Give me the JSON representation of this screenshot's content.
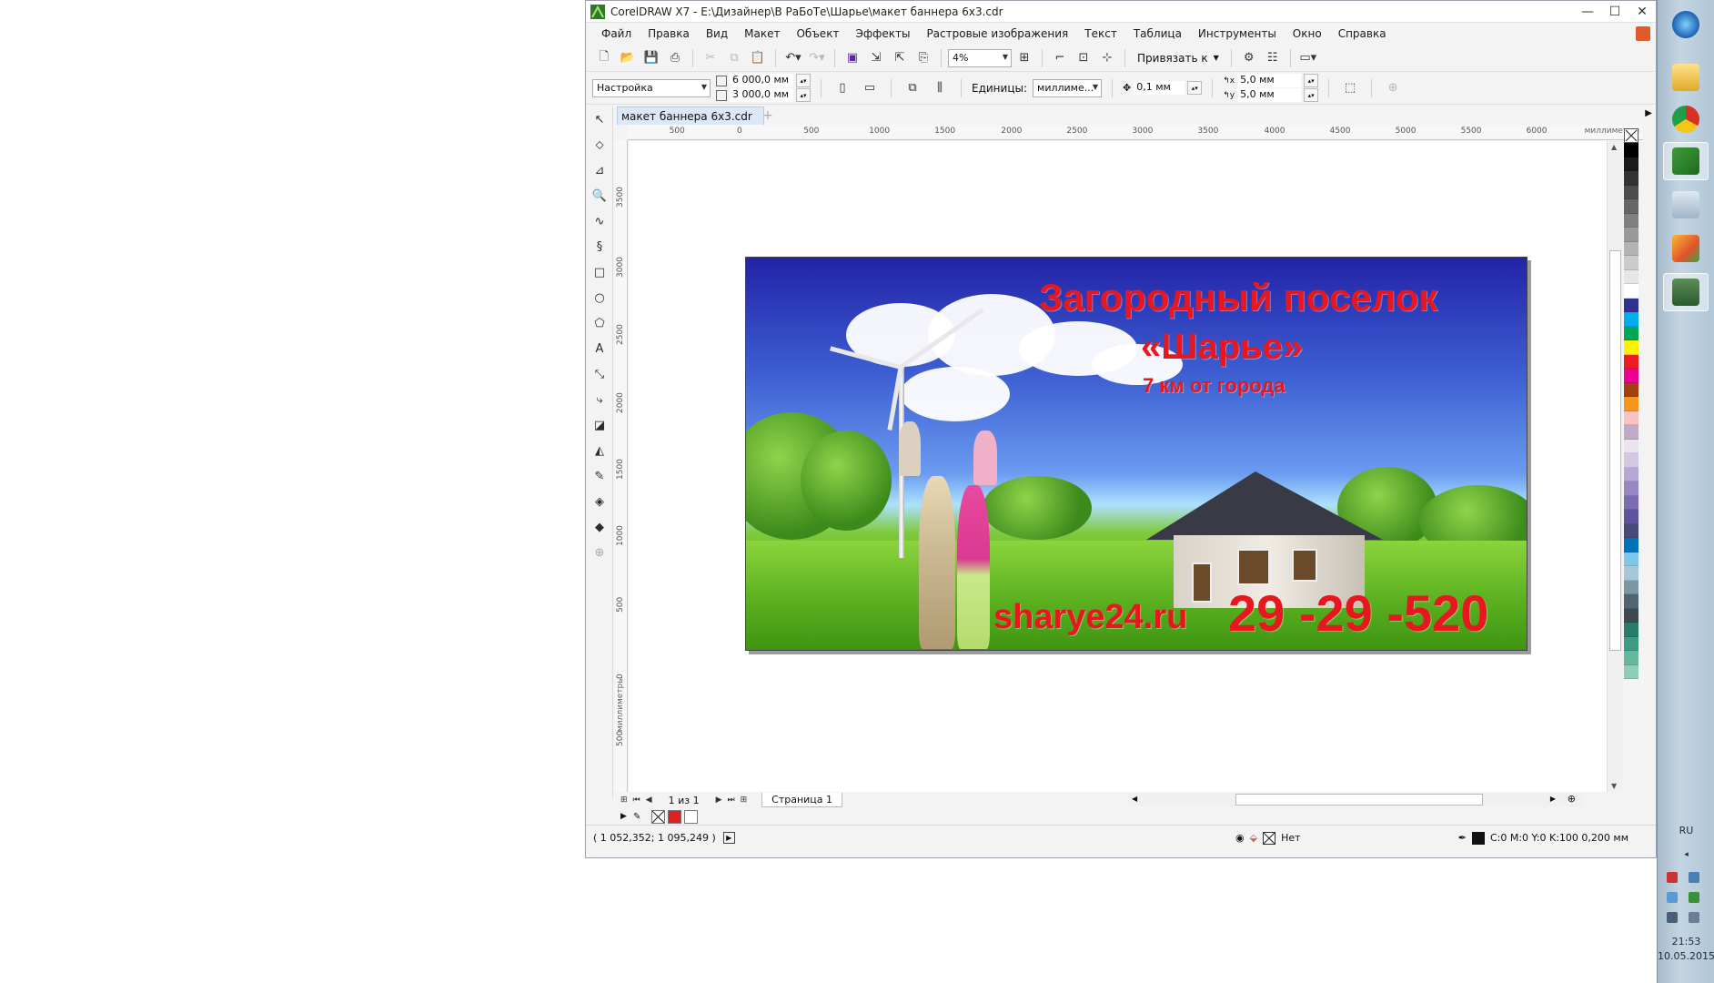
{
  "window": {
    "title": "CorelDRAW X7 - E:\\Дизайнер\\В РаБоТе\\Шарье\\макет баннера 6х3.cdr",
    "minimize": "—",
    "maximize": "☐",
    "close": "✕"
  },
  "menu": {
    "items": [
      "Файл",
      "Правка",
      "Вид",
      "Макет",
      "Объект",
      "Эффекты",
      "Растровые изображения",
      "Текст",
      "Таблица",
      "Инструменты",
      "Окно",
      "Справка"
    ]
  },
  "toolbar": {
    "zoom": "4%",
    "snap_label": "Привязать к"
  },
  "propbar": {
    "preset": "Настройка",
    "width": "6 000,0 мм",
    "height": "3 000,0 мм",
    "units_label": "Единицы:",
    "units_value": "миллиме...",
    "nudge": "0,1 мм",
    "dup_x": "5,0 мм",
    "dup_y": "5,0 мм"
  },
  "document": {
    "tab_name": "макет баннера 6х3.cdr"
  },
  "rulers": {
    "h_ticks": [
      "500",
      "0",
      "500",
      "1000",
      "1500",
      "2000",
      "2500",
      "3000",
      "3500",
      "4000",
      "4500",
      "5000",
      "5500",
      "6000"
    ],
    "h_unit": "миллиметры",
    "v_ticks": [
      "3500",
      "3000",
      "2500",
      "2000",
      "1500",
      "1000",
      "500",
      "0",
      "500"
    ],
    "v_unit": "миллиметры"
  },
  "banner": {
    "headline": "Загородный поселок",
    "name": "«Шарье»",
    "distance": "7 км от города",
    "website": "sharye24.ru",
    "phone": "29 -29 -520"
  },
  "pages": {
    "counter": "1 из 1",
    "page_tab": "Страница 1"
  },
  "status": {
    "coords": "( 1 052,352; 1 095,249 )",
    "fill_label": "Нет",
    "outline": "C:0 M:0 Y:0 K:100  0,200 мм"
  },
  "palette_colors": [
    "#000000",
    "#1a1a1a",
    "#333333",
    "#4d4d4d",
    "#666666",
    "#808080",
    "#999999",
    "#b3b3b3",
    "#cccccc",
    "#e6e6e6",
    "#ffffff",
    "#2e3192",
    "#00aeef",
    "#00a651",
    "#fff200",
    "#ed1c24",
    "#ec008c",
    "#a0410d",
    "#f7941d",
    "#f9c3c6",
    "#c0a9c9",
    "#e9e4f0",
    "#d3c8e4",
    "#b5a7d6",
    "#9787c4",
    "#7b6cb3",
    "#5f52a1",
    "#484a78",
    "#0072bc",
    "#7fc6ea",
    "#a7c7d9",
    "#7c96a4",
    "#4f6570",
    "#3d4a52",
    "#2b7b6a",
    "#3e9c84",
    "#63b89f",
    "#8ccfb9"
  ],
  "doc_palette": [
    "#e02020",
    "#ffffff"
  ],
  "taskbar": {
    "lang": "RU",
    "time": "21:53",
    "date": "10.05.2015"
  }
}
